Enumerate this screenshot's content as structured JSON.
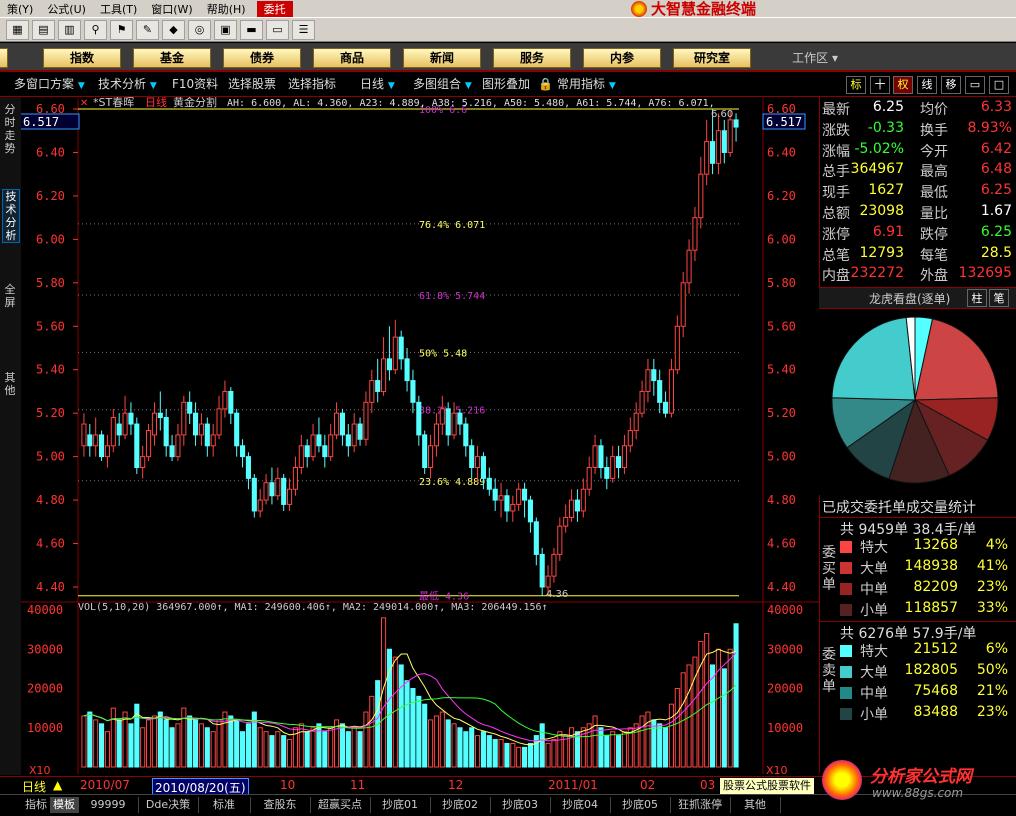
{
  "menubar": {
    "items": [
      "策(Y)",
      "公式(U)",
      "工具(T)",
      "窗口(W)",
      "帮助(H)"
    ],
    "highlight": "委托",
    "brand": "大智慧金融终端"
  },
  "catbar": {
    "items": [
      "指数",
      "基金",
      "债券",
      "商品",
      "新闻",
      "服务",
      "内参",
      "研究室"
    ],
    "work_area": "工作区"
  },
  "winbar": {
    "items": [
      "多窗口方案",
      "技术分析",
      "F10资料",
      "选择股票",
      "选择指标",
      "日线",
      "多图组合",
      "图形叠加",
      "常用指标"
    ],
    "right_buttons": [
      "标",
      "十",
      "权",
      "线",
      "移"
    ]
  },
  "left_tabs": [
    "分时走势",
    "技术分析",
    "全屏",
    "其他"
  ],
  "chart": {
    "current_price_tag": "6.517",
    "info_prefix": "*ST春晖",
    "info_period": "日线",
    "info_indicator": "黄金分割",
    "info_values": "AH: 6.600, AL: 4.360, A23: 4.889, A38: 5.216, A50: 5.480, A61: 5.744, A76: 6.071,",
    "price_ticks": [
      "6.60",
      "6.40",
      "6.20",
      "6.00",
      "5.80",
      "5.60",
      "5.40",
      "5.20",
      "5.00",
      "4.80",
      "4.60",
      "4.40"
    ],
    "fib_labels": [
      {
        "text": "100%  6.6",
        "value": 6.6,
        "color": "#c3c"
      },
      {
        "text": "76.4%  6.071",
        "value": 6.071,
        "color": "#ff6"
      },
      {
        "text": "61.8%  5.744",
        "value": 5.744,
        "color": "#c3c"
      },
      {
        "text": "50%  5.48",
        "value": 5.48,
        "color": "#ff6"
      },
      {
        "text": "38.2%  5.216",
        "value": 5.216,
        "color": "#c3c"
      },
      {
        "text": "23.6%  4.889",
        "value": 4.889,
        "color": "#ff6"
      },
      {
        "text": "最低  4.36",
        "value": 4.36,
        "color": "#c3c"
      }
    ],
    "high_label": "6.60",
    "low_label": "4.36",
    "vol_info": "VOL(5,10,20)  364967.000↑, MA1: 249600.406↑, MA2: 249014.000↑, MA3: 206449.156↑",
    "vol_ticks": [
      "40000",
      "30000",
      "20000",
      "10000"
    ],
    "vol_unit": "X10",
    "date_axis": [
      "2010/07",
      "2010/08/20(五)",
      "10",
      "11",
      "12",
      "2011/01",
      "02",
      "03"
    ]
  },
  "chart_data": {
    "type": "candlestick",
    "y_range": [
      4.36,
      6.6
    ],
    "vol_range": [
      0,
      40000
    ],
    "candles": [
      [
        5.05,
        5.15,
        5.2,
        5.0,
        13000
      ],
      [
        5.1,
        5.05,
        5.15,
        5.0,
        14000
      ],
      [
        5.05,
        5.1,
        5.18,
        5.0,
        12000
      ],
      [
        5.1,
        5.0,
        5.12,
        4.98,
        11000
      ],
      [
        5.0,
        5.05,
        5.1,
        4.95,
        9000
      ],
      [
        5.05,
        5.18,
        5.22,
        5.02,
        15000
      ],
      [
        5.15,
        5.1,
        5.2,
        5.05,
        12000
      ],
      [
        5.1,
        5.2,
        5.28,
        5.08,
        14000
      ],
      [
        5.2,
        5.15,
        5.25,
        5.1,
        11000
      ],
      [
        5.15,
        4.95,
        5.18,
        4.92,
        16000
      ],
      [
        4.95,
        5.0,
        5.05,
        4.9,
        10000
      ],
      [
        5.0,
        5.12,
        5.15,
        4.98,
        12000
      ],
      [
        5.1,
        5.2,
        5.25,
        5.05,
        13000
      ],
      [
        5.2,
        5.18,
        5.3,
        5.12,
        14000
      ],
      [
        5.18,
        5.05,
        5.22,
        5.0,
        12000
      ],
      [
        5.05,
        5.0,
        5.1,
        4.98,
        10000
      ],
      [
        5.0,
        5.1,
        5.15,
        4.98,
        11000
      ],
      [
        5.1,
        5.25,
        5.28,
        5.05,
        15000
      ],
      [
        5.25,
        5.2,
        5.3,
        5.15,
        13000
      ],
      [
        5.2,
        5.1,
        5.25,
        5.05,
        12000
      ],
      [
        5.1,
        5.15,
        5.2,
        5.05,
        11000
      ],
      [
        5.15,
        5.05,
        5.18,
        5.0,
        10000
      ],
      [
        5.05,
        5.1,
        5.15,
        5.0,
        9000
      ],
      [
        5.1,
        5.22,
        5.28,
        5.08,
        12000
      ],
      [
        5.22,
        5.3,
        5.35,
        5.18,
        14000
      ],
      [
        5.3,
        5.2,
        5.32,
        5.15,
        13000
      ],
      [
        5.2,
        5.05,
        5.22,
        5.0,
        12000
      ],
      [
        5.05,
        5.0,
        5.08,
        4.95,
        9000
      ],
      [
        5.0,
        4.9,
        5.02,
        4.85,
        11000
      ],
      [
        4.9,
        4.75,
        4.92,
        4.72,
        14000
      ],
      [
        4.75,
        4.8,
        4.85,
        4.72,
        10000
      ],
      [
        4.8,
        4.88,
        4.92,
        4.78,
        9000
      ],
      [
        4.88,
        4.82,
        4.95,
        4.78,
        8000
      ],
      [
        4.82,
        4.9,
        4.95,
        4.8,
        9000
      ],
      [
        4.9,
        4.78,
        4.92,
        4.75,
        8000
      ],
      [
        4.78,
        4.85,
        4.9,
        4.75,
        7000
      ],
      [
        4.85,
        4.95,
        5.0,
        4.82,
        10000
      ],
      [
        4.95,
        5.05,
        5.1,
        4.92,
        11000
      ],
      [
        5.05,
        5.0,
        5.08,
        4.95,
        9000
      ],
      [
        5.0,
        5.1,
        5.15,
        4.98,
        10000
      ],
      [
        5.1,
        5.05,
        5.18,
        5.02,
        11000
      ],
      [
        5.05,
        5.0,
        5.1,
        4.95,
        9000
      ],
      [
        5.0,
        5.1,
        5.15,
        4.98,
        10000
      ],
      [
        5.1,
        5.2,
        5.25,
        5.08,
        12000
      ],
      [
        5.2,
        5.1,
        5.22,
        5.05,
        11000
      ],
      [
        5.1,
        5.05,
        5.15,
        5.0,
        9000
      ],
      [
        5.05,
        5.15,
        5.2,
        5.02,
        10000
      ],
      [
        5.15,
        5.08,
        5.18,
        5.05,
        9000
      ],
      [
        5.08,
        5.25,
        5.3,
        5.05,
        14000
      ],
      [
        5.25,
        5.35,
        5.4,
        5.2,
        18000
      ],
      [
        5.35,
        5.3,
        5.45,
        5.25,
        22000
      ],
      [
        5.3,
        5.45,
        5.55,
        5.28,
        38000
      ],
      [
        5.45,
        5.4,
        5.6,
        5.35,
        30000
      ],
      [
        5.4,
        5.55,
        5.63,
        5.38,
        28000
      ],
      [
        5.55,
        5.45,
        5.58,
        5.4,
        26000
      ],
      [
        5.45,
        5.35,
        5.5,
        5.3,
        22000
      ],
      [
        5.35,
        5.25,
        5.4,
        5.2,
        20000
      ],
      [
        5.25,
        5.1,
        5.28,
        5.05,
        18000
      ],
      [
        5.1,
        4.95,
        5.12,
        4.92,
        16000
      ],
      [
        4.95,
        5.05,
        5.1,
        4.9,
        12000
      ],
      [
        5.05,
        5.15,
        5.2,
        5.0,
        13000
      ],
      [
        5.15,
        5.22,
        5.28,
        5.1,
        14000
      ],
      [
        5.22,
        5.1,
        5.25,
        5.05,
        12000
      ],
      [
        5.1,
        5.2,
        5.25,
        5.08,
        11000
      ],
      [
        5.2,
        5.15,
        5.22,
        5.1,
        10000
      ],
      [
        5.15,
        5.05,
        5.18,
        5.0,
        9000
      ],
      [
        5.05,
        4.95,
        5.08,
        4.9,
        10000
      ],
      [
        4.95,
        5.0,
        5.05,
        4.88,
        8000
      ],
      [
        5.0,
        4.9,
        5.02,
        4.85,
        9000
      ],
      [
        4.9,
        4.85,
        4.95,
        4.82,
        8000
      ],
      [
        4.85,
        4.8,
        4.9,
        4.75,
        7000
      ],
      [
        4.8,
        4.82,
        4.88,
        4.72,
        7000
      ],
      [
        4.82,
        4.75,
        4.85,
        4.7,
        6000
      ],
      [
        4.75,
        4.78,
        4.82,
        4.7,
        6000
      ],
      [
        4.78,
        4.85,
        4.88,
        4.75,
        5000
      ],
      [
        4.85,
        4.8,
        4.88,
        4.72,
        5000
      ],
      [
        4.8,
        4.7,
        4.82,
        4.65,
        6000
      ],
      [
        4.7,
        4.55,
        4.72,
        4.5,
        8000
      ],
      [
        4.55,
        4.4,
        4.58,
        4.36,
        11000
      ],
      [
        4.4,
        4.45,
        4.5,
        4.36,
        6000
      ],
      [
        4.45,
        4.55,
        4.58,
        4.42,
        7000
      ],
      [
        4.55,
        4.68,
        4.72,
        4.52,
        9000
      ],
      [
        4.68,
        4.72,
        4.78,
        4.65,
        8000
      ],
      [
        4.72,
        4.8,
        4.85,
        4.7,
        10000
      ],
      [
        4.8,
        4.75,
        4.85,
        4.7,
        9000
      ],
      [
        4.75,
        4.85,
        4.9,
        4.72,
        10000
      ],
      [
        4.85,
        4.95,
        5.0,
        4.82,
        11000
      ],
      [
        4.95,
        5.05,
        5.1,
        4.92,
        13000
      ],
      [
        5.05,
        4.95,
        5.08,
        4.9,
        10000
      ],
      [
        4.95,
        4.9,
        5.0,
        4.85,
        8000
      ],
      [
        4.9,
        5.0,
        5.05,
        4.88,
        9000
      ],
      [
        5.0,
        4.95,
        5.05,
        4.9,
        8000
      ],
      [
        4.95,
        5.05,
        5.1,
        4.92,
        9000
      ],
      [
        5.05,
        5.12,
        5.18,
        5.02,
        10000
      ],
      [
        5.12,
        5.2,
        5.25,
        5.08,
        11000
      ],
      [
        5.2,
        5.3,
        5.35,
        5.18,
        13000
      ],
      [
        5.3,
        5.4,
        5.45,
        5.25,
        14000
      ],
      [
        5.4,
        5.35,
        5.45,
        5.28,
        12000
      ],
      [
        5.35,
        5.25,
        5.4,
        5.2,
        11000
      ],
      [
        5.25,
        5.2,
        5.3,
        5.18,
        10000
      ],
      [
        5.2,
        5.4,
        5.45,
        5.18,
        16000
      ],
      [
        5.4,
        5.6,
        5.65,
        5.38,
        20000
      ],
      [
        5.6,
        5.8,
        5.85,
        5.55,
        24000
      ],
      [
        5.8,
        5.95,
        6.0,
        5.75,
        26000
      ],
      [
        5.95,
        6.1,
        6.15,
        5.9,
        28000
      ],
      [
        6.1,
        6.3,
        6.38,
        6.05,
        32000
      ],
      [
        6.3,
        6.45,
        6.55,
        6.25,
        34000
      ],
      [
        6.45,
        6.35,
        6.6,
        6.3,
        26000
      ],
      [
        6.35,
        6.5,
        6.58,
        6.3,
        30000
      ],
      [
        6.5,
        6.4,
        6.55,
        6.35,
        25000
      ],
      [
        6.4,
        6.55,
        6.6,
        6.38,
        30000
      ],
      [
        6.55,
        6.517,
        6.58,
        6.45,
        36497
      ]
    ]
  },
  "quote": {
    "rows": [
      [
        "最新",
        "6.25",
        "均价",
        "6.33"
      ],
      [
        "涨跌",
        "-0.33",
        "换手",
        "8.93%"
      ],
      [
        "涨幅",
        "-5.02%",
        "今开",
        "6.42"
      ],
      [
        "总手",
        "364967",
        "最高",
        "6.48"
      ],
      [
        "现手",
        "1627",
        "最低",
        "6.25"
      ],
      [
        "总额",
        "23098",
        "量比",
        "1.67"
      ],
      [
        "涨停",
        "6.91",
        "跌停",
        "6.25"
      ],
      [
        "总笔",
        "12793",
        "每笔",
        "28.5"
      ],
      [
        "内盘",
        "232272",
        "外盘",
        "132695"
      ]
    ],
    "dragon_title": "龙虎看盘(逐单)",
    "dragon_btn1": "柱",
    "dragon_btn2": "笔"
  },
  "pie_data": [
    {
      "value": 4,
      "color": "#5ff"
    },
    {
      "value": 25,
      "color": "#c44"
    },
    {
      "value": 10,
      "color": "#922"
    },
    {
      "value": 12,
      "color": "#622"
    },
    {
      "value": 14,
      "color": "#422"
    },
    {
      "value": 12,
      "color": "#244"
    },
    {
      "value": 12,
      "color": "#388"
    },
    {
      "value": 27,
      "color": "#4cc"
    },
    {
      "value": 2,
      "color": "#fff"
    }
  ],
  "orders": {
    "title": "已成交委托单成交量统计",
    "buy": {
      "summary": "共 9459单 38.4手/单",
      "side_label": "委买单",
      "rows": [
        {
          "label": "特大",
          "vol": "13268",
          "pct": "4%",
          "color": "#f44"
        },
        {
          "label": "大单",
          "vol": "148938",
          "pct": "41%",
          "color": "#c33"
        },
        {
          "label": "中单",
          "vol": "82209",
          "pct": "23%",
          "color": "#922"
        },
        {
          "label": "小单",
          "vol": "118857",
          "pct": "33%",
          "color": "#522"
        }
      ]
    },
    "sell": {
      "summary": "共 6276单 57.9手/单",
      "side_label": "委卖单",
      "rows": [
        {
          "label": "特大",
          "vol": "21512",
          "pct": "6%",
          "color": "#5ff"
        },
        {
          "label": "大单",
          "vol": "182805",
          "pct": "50%",
          "color": "#4cc"
        },
        {
          "label": "中单",
          "vol": "75468",
          "pct": "21%",
          "color": "#288"
        },
        {
          "label": "小单",
          "vol": "83488",
          "pct": "23%",
          "color": "#244"
        }
      ]
    }
  },
  "periodbar": {
    "label": "日线"
  },
  "bottom_tabs": [
    "指标",
    "模板",
    "99999",
    "Dde决策",
    "标准",
    "查股东",
    "超赢买点",
    "抄底01",
    "抄底02",
    "抄底03",
    "抄底04",
    "抄底05",
    "狂抓涨停",
    "其他"
  ],
  "status_text": "股票公式股票软件",
  "watermark": {
    "title": "分析家公式网",
    "url": "www.88gs.com"
  }
}
